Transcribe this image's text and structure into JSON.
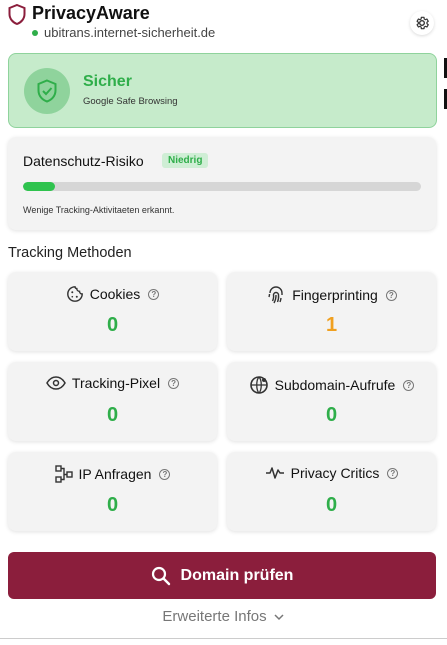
{
  "header": {
    "app_title": "PrivacyAware",
    "domain": "ubitrans.internet-sicherheit.de",
    "status_color": "#2fae4a",
    "brand_color": "#8b1e3c",
    "settings_icon": "gear-icon"
  },
  "safety": {
    "title": "Sicher",
    "subtitle": "Google Safe Browsing",
    "icon": "shield-check-icon"
  },
  "risk": {
    "title": "Datenschutz-Risiko",
    "badge": "Niedrig",
    "progress_fraction": 0.08,
    "description": "Wenige Tracking-Aktivitaeten erkannt."
  },
  "tracking": {
    "title": "Tracking Methoden",
    "items": [
      {
        "label": "Cookies",
        "value": "0",
        "icon": "cookie-icon",
        "color": "#2fae4a"
      },
      {
        "label": "Fingerprinting",
        "value": "1",
        "icon": "fingerprint-icon",
        "color": "#f0a020"
      },
      {
        "label": "Tracking-Pixel",
        "value": "0",
        "icon": "eye-icon",
        "color": "#2fae4a"
      },
      {
        "label": "Subdomain-Aufrufe",
        "value": "0",
        "icon": "globe-icon",
        "color": "#2fae4a"
      },
      {
        "label": "IP Anfragen",
        "value": "0",
        "icon": "network-icon",
        "color": "#2fae4a"
      },
      {
        "label": "Privacy Critics",
        "value": "0",
        "icon": "pulse-icon",
        "color": "#2fae4a"
      }
    ]
  },
  "actions": {
    "check_label": "Domain prüfen",
    "more_info_label": "Erweiterte Infos"
  }
}
